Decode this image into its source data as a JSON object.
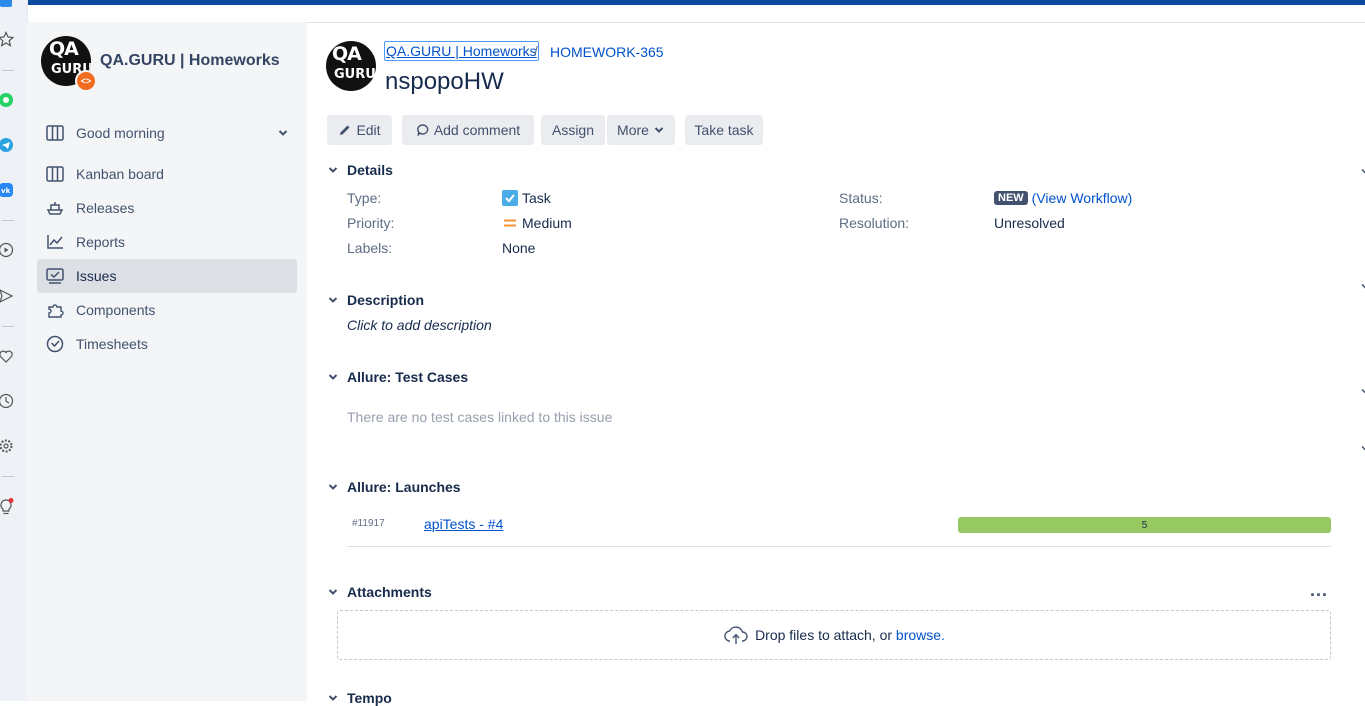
{
  "sidebar": {
    "project_name": "QA.GURU | Homeworks",
    "logo_text_top": "QA",
    "logo_text_bottom": "GURU",
    "items": [
      {
        "label": "Good morning",
        "icon": "board-icon"
      },
      {
        "label": "Kanban board",
        "icon": "columns-icon"
      },
      {
        "label": "Releases",
        "icon": "ship-icon"
      },
      {
        "label": "Reports",
        "icon": "chart-icon"
      },
      {
        "label": "Issues",
        "icon": "issues-icon"
      },
      {
        "label": "Components",
        "icon": "puzzle-icon"
      },
      {
        "label": "Timesheets",
        "icon": "clock-icon"
      }
    ]
  },
  "breadcrumb": {
    "project": "QA.GURU | Homeworks",
    "separator": "/",
    "issue_key": "HOMEWORK-365"
  },
  "issue": {
    "title": "nspopoHW"
  },
  "toolbar": {
    "edit": "Edit",
    "add_comment": "Add comment",
    "assign": "Assign",
    "more": "More",
    "take_task": "Take task"
  },
  "details": {
    "heading": "Details",
    "type_label": "Type:",
    "type_value": "Task",
    "priority_label": "Priority:",
    "priority_value": "Medium",
    "labels_label": "Labels:",
    "labels_value": "None",
    "status_label": "Status:",
    "status_value": "NEW",
    "workflow_link": "(View Workflow)",
    "resolution_label": "Resolution:",
    "resolution_value": "Unresolved"
  },
  "description": {
    "heading": "Description",
    "placeholder": "Click to add description"
  },
  "test_cases": {
    "heading": "Allure: Test Cases",
    "empty": "There are no test cases linked to this issue"
  },
  "launches": {
    "heading": "Allure: Launches",
    "items": [
      {
        "id": "#11917",
        "name": "apiTests - #4",
        "passed": 5,
        "passed_fraction": 1.0
      }
    ]
  },
  "attachments": {
    "heading": "Attachments",
    "more": "...",
    "drop_text": "Drop files to attach, or",
    "browse": "browse."
  },
  "tempo": {
    "heading": "Tempo"
  },
  "colors": {
    "accent": "#0052cc",
    "topbar": "#0b4a9e",
    "success": "#97c963",
    "priority_medium": "#f79232",
    "lozenge": "#42526e"
  }
}
